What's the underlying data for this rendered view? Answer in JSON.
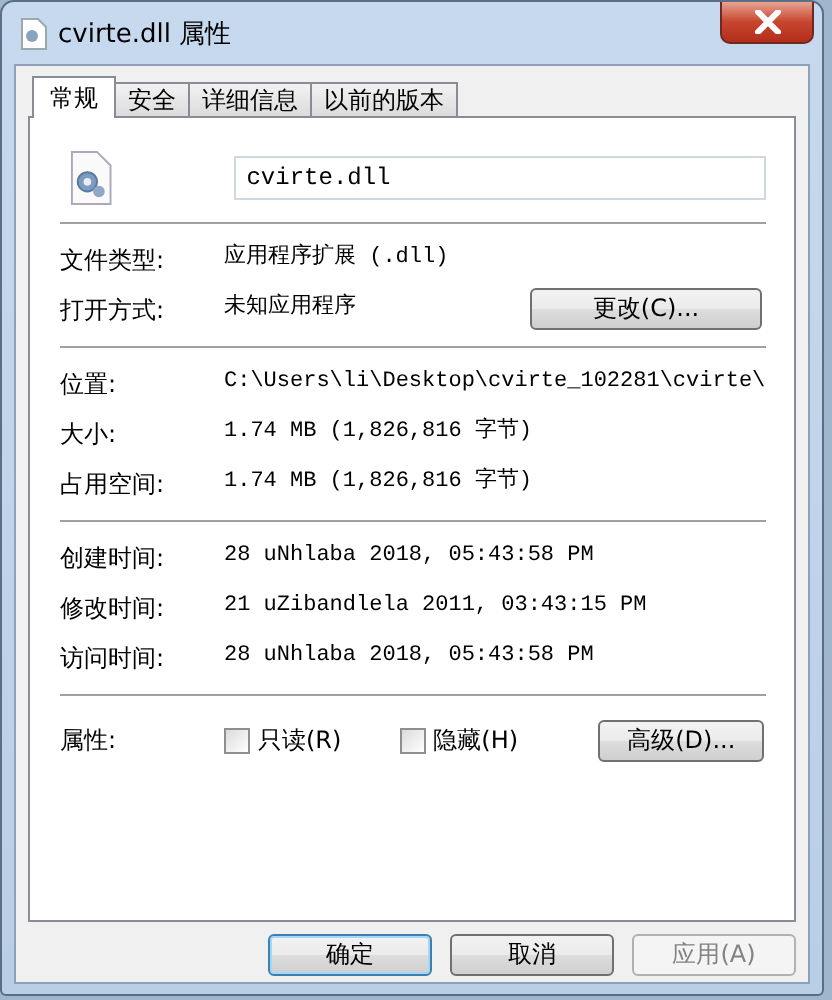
{
  "window": {
    "title": "cvirte.dll 属性"
  },
  "tabs": [
    {
      "label": "常规",
      "selected": true
    },
    {
      "label": "安全",
      "selected": false
    },
    {
      "label": "详细信息",
      "selected": false
    },
    {
      "label": "以前的版本",
      "selected": false
    }
  ],
  "file": {
    "name": "cvirte.dll"
  },
  "sections": [
    {
      "rows": [
        {
          "label": "文件类型:",
          "value": "应用程序扩展 (.dll)"
        },
        {
          "label": "打开方式:",
          "value": "未知应用程序",
          "button": "更改(C)..."
        }
      ]
    },
    {
      "rows": [
        {
          "label": "位置:",
          "value": "C:\\Users\\li\\Desktop\\cvirte_102281\\cvirte\\"
        },
        {
          "label": "大小:",
          "value": "1.74 MB (1,826,816 字节)"
        },
        {
          "label": "占用空间:",
          "value": "1.74 MB (1,826,816 字节)"
        }
      ]
    },
    {
      "rows": [
        {
          "label": "创建时间:",
          "value": "28 uNhlaba 2018, 05:43:58 PM"
        },
        {
          "label": "修改时间:",
          "value": "21 uZibandlela 2011, 03:43:15 PM"
        },
        {
          "label": "访问时间:",
          "value": "28 uNhlaba 2018, 05:43:58 PM"
        }
      ]
    }
  ],
  "attributes": {
    "label": "属性:",
    "checkboxes": [
      {
        "label": "只读(R)",
        "checked": false
      },
      {
        "label": "隐藏(H)",
        "checked": false
      }
    ],
    "button": "高级(D)..."
  },
  "buttons": [
    {
      "label": "确定",
      "default": true,
      "disabled": false
    },
    {
      "label": "取消",
      "default": false,
      "disabled": false
    },
    {
      "label": "应用(A)",
      "default": false,
      "disabled": true
    }
  ]
}
